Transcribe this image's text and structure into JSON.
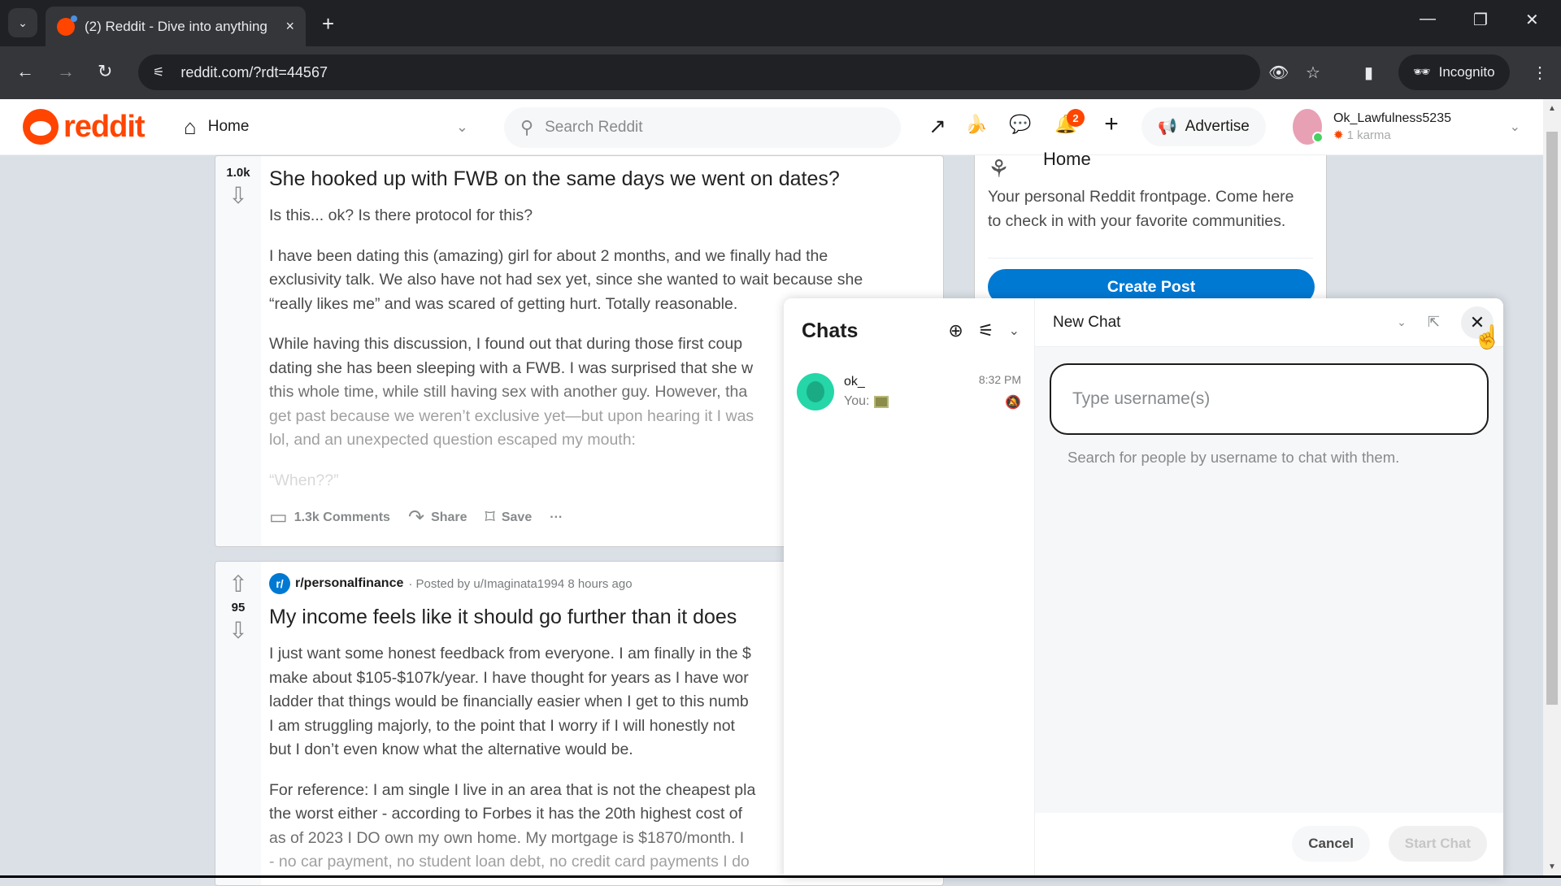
{
  "browser": {
    "tab_title": "(2) Reddit - Dive into anything",
    "url": "reddit.com/?rdt=44567",
    "incognito_label": "Incognito",
    "icons": {
      "tab_list": "chevron-down",
      "tab_close": "×",
      "new_tab": "+",
      "back": "←",
      "forward": "→",
      "reload": "↻",
      "site_info": "⚟",
      "eye_off": "👁",
      "star": "☆",
      "side_panel": "▮",
      "menu": "⋮",
      "minimize": "—",
      "restore": "❐",
      "close": "✕"
    }
  },
  "header": {
    "logo_text": "reddit",
    "feed_selector": "Home",
    "search_placeholder": "Search Reddit",
    "notification_count": "2",
    "advertise_label": "Advertise",
    "username": "Ok_Lawfulness5235",
    "karma": "1 karma",
    "icons": {
      "popular": "↗",
      "coins": "🍌",
      "chat": "💬",
      "notifications": "🔔",
      "create": "+",
      "advertise": "📢",
      "home": "⌂",
      "search": "⚲"
    }
  },
  "feed": {
    "posts": [
      {
        "score": "1.0k",
        "title": "She hooked up with FWB on the same days we went on dates?",
        "body": [
          "Is this... ok? Is there protocol for this?",
          "I have been dating this (amazing) girl for about 2 months, and we finally had the",
          "exclusivity talk. We also have not had sex yet, since she wanted to wait because she",
          "“really likes me” and was scared of getting hurt. Totally reasonable.",
          "While having this discussion, I found out that during those first coup",
          "dating she has been sleeping with a FWB. I was surprised that she w",
          "this whole time, while still having sex with another guy. However, tha",
          "get past because we weren’t exclusive yet—but upon hearing it I was",
          "lol, and an unexpected question escaped my mouth:",
          "“When??”"
        ],
        "comments_label": "1.3k Comments",
        "share_label": "Share",
        "save_label": "Save",
        "more_label": "···"
      },
      {
        "subreddit": "r/personalfinance",
        "posted_by": "· Posted by u/Imaginata1994 8 hours ago",
        "score": "95",
        "title": "My income feels like it should go further than it does",
        "body": [
          "I just want some honest feedback from everyone. I am finally in the $",
          "make about $105-$107k/year. I have thought for years as I have wor",
          "ladder that things would be financially easier when I get to this numb",
          "I am struggling majorly, to the point that I worry if I will honestly not",
          "but I don’t even know what the alternative would be.",
          "For reference: I am single I live in an area that is not the cheapest pla",
          "the worst either - according to Forbes it has the 20th highest cost of",
          "as of 2023 I DO own my own home. My mortgage is $1870/month. I",
          "- no car payment, no student loan debt, no credit card payments I do"
        ]
      }
    ]
  },
  "sidebar": {
    "title": "Home",
    "description_line1": "Your personal Reddit frontpage. Come here",
    "description_line2": "to check in with your favorite communities.",
    "create_post_label": "Create Post"
  },
  "chat": {
    "list_title": "Chats",
    "items": [
      {
        "name": "ok_",
        "preview_prefix": "You:",
        "time": "8:32 PM"
      }
    ],
    "panel_title": "New Chat",
    "username_placeholder": "Type username(s)",
    "username_value": "",
    "hint": "Search for people by username to chat with them.",
    "cancel_label": "Cancel",
    "start_label": "Start Chat"
  }
}
